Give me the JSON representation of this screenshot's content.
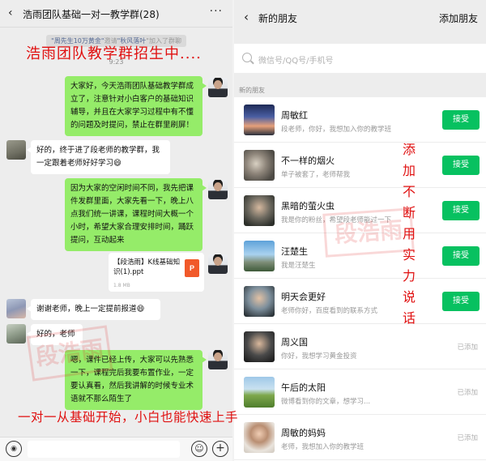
{
  "left_chat": {
    "title": "浩雨团队基础一对一教学群(28)",
    "system_notice": {
      "inviter": "\"周先生10万黄金\"",
      "text1": "邀请",
      "invitee": "\"秋风落叶",
      "text2": "\"加入了群聊"
    },
    "timestamp": "9:23",
    "messages": [
      {
        "text": "大家好，今天浩雨团队基础教学群成立了，注意针对小白客户的基础知识辅导，并且在大家学习过程中有不懂的问题及时提问，禁止在群里刷屏！"
      },
      {
        "text": "好的，终于进了段老师的教学群，我一定跟着老师好好学习😄"
      },
      {
        "text": "因为大家的空闲时间不同，我先把课件发群里面，大家先看一下，晚上八点我们统一讲课，课程时间大概一个小时，希望大家合理安排时间，踊跃提问，互动起来"
      },
      {
        "text": "谢谢老师，晚上一定提前报道😄"
      },
      {
        "text": "好的，老师"
      },
      {
        "text": "嗯，课件已经上传，大家可以先熟悉一下，课程完后我要布置作业，一定要认真看，然后我讲解的时候专业术语就不那么陌生了"
      }
    ],
    "file": {
      "name": "【段浩雨】K线基础知识(1).ppt",
      "size": "1.8 MB",
      "type_glyph": "P"
    },
    "input": {
      "voice_glyph": "◉",
      "emoji_glyph": "☺",
      "plus_glyph": "+"
    }
  },
  "right_panel": {
    "title": "新的朋友",
    "add_label": "添加朋友",
    "search_placeholder": "微信号/QQ号/手机号",
    "section_label": "新的朋友",
    "accept_label": "接受",
    "added_label": "已添加",
    "friends": [
      {
        "name": "周敏红",
        "message": "段老师，你好，我想加入你的教学班",
        "status": "accept"
      },
      {
        "name": "不一样的烟火",
        "message": "单子被套了，老师帮我",
        "status": "accept"
      },
      {
        "name": "黑暗的萤火虫",
        "message": "我是你的粉丝，希望段老师能过一下",
        "status": "accept"
      },
      {
        "name": "汪楚生",
        "message": "我是汪楚生",
        "status": "accept"
      },
      {
        "name": "明天会更好",
        "message": "老师你好，百度看到的联系方式",
        "status": "accept"
      },
      {
        "name": "周义国",
        "message": "你好，我想学习黄金投资",
        "status": "added"
      },
      {
        "name": "午后的太阳",
        "message": "微博看到你的文章，想学习...",
        "status": "added"
      },
      {
        "name": "周敏的妈妈",
        "message": "老师，我想加入你的教学班",
        "status": "added"
      }
    ]
  },
  "overlays": {
    "top_text": "浩雨团队教学群招生中....",
    "vertical_text": "添加不断用实力说话",
    "bottom_text": "一对一从基础开始，小白也能快速上手",
    "watermark": "段浩雨"
  },
  "colors": {
    "wechat_green": "#07c160",
    "bubble_green": "#95ec69",
    "overlay_red": "#e01010"
  }
}
